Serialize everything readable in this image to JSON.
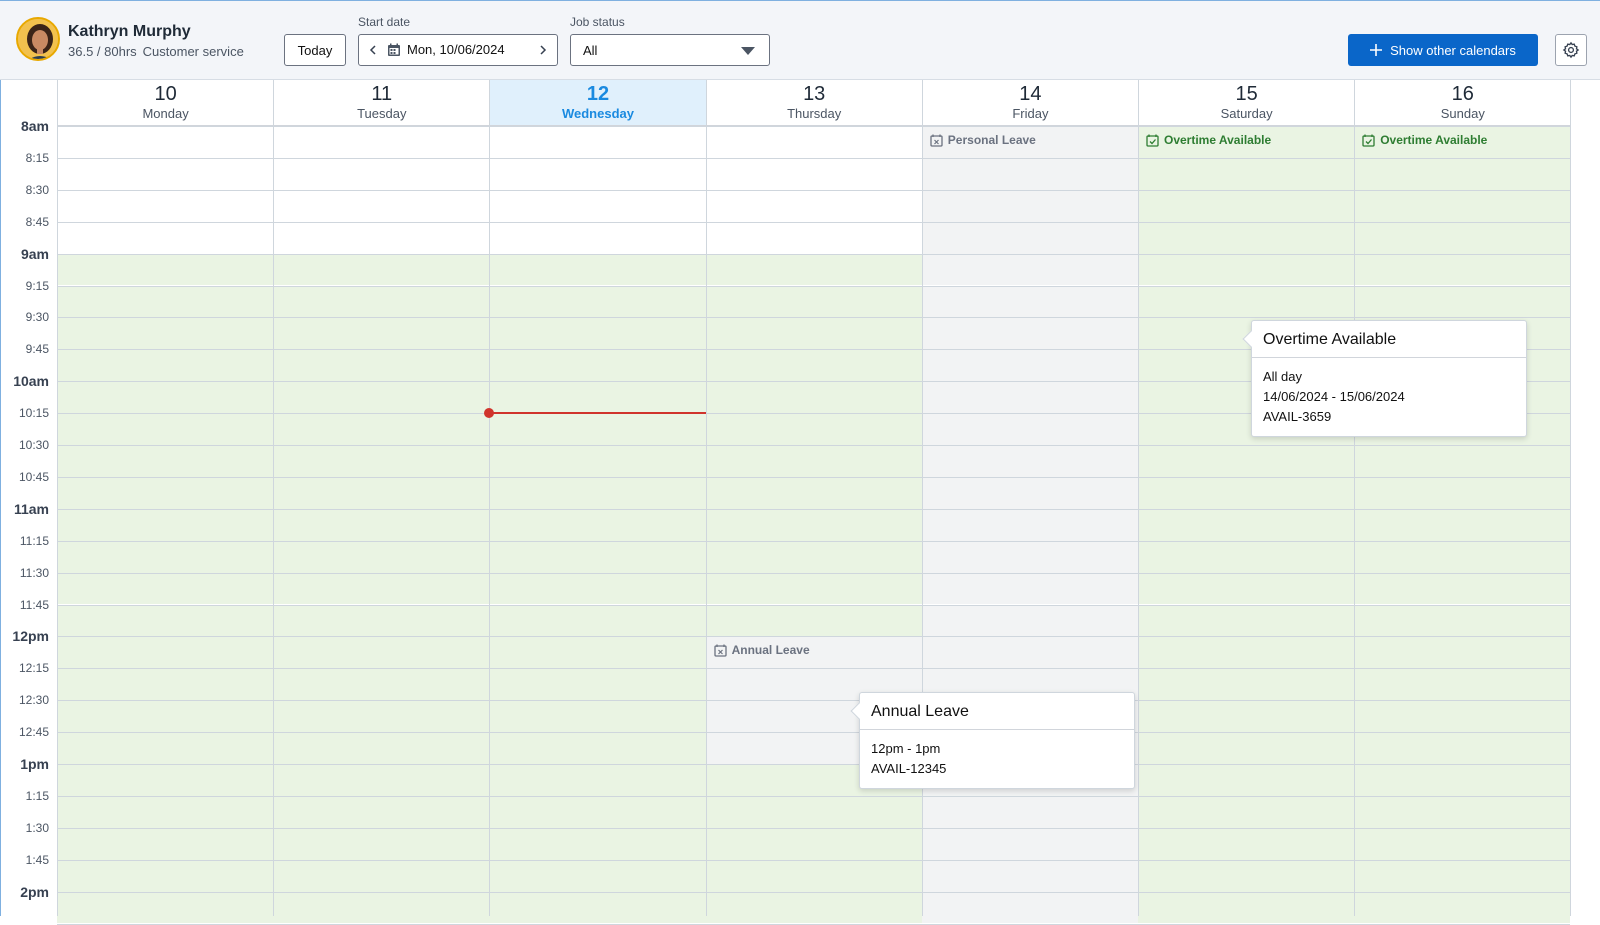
{
  "user": {
    "name": "Kathryn Murphy",
    "hours": "36.5 / 80hrs",
    "department": "Customer service"
  },
  "toolbar": {
    "today_label": "Today",
    "start_date_label": "Start date",
    "start_date_value": "Mon, 10/06/2024",
    "job_status_label": "Job status",
    "job_status_value": "All",
    "show_calendars_label": "Show other calendars"
  },
  "days": [
    {
      "num": "10",
      "name": "Monday"
    },
    {
      "num": "11",
      "name": "Tuesday"
    },
    {
      "num": "12",
      "name": "Wednesday",
      "today": true
    },
    {
      "num": "13",
      "name": "Thursday"
    },
    {
      "num": "14",
      "name": "Friday"
    },
    {
      "num": "15",
      "name": "Saturday"
    },
    {
      "num": "16",
      "name": "Sunday"
    }
  ],
  "times": [
    "8am",
    "8:15",
    "8:30",
    "8:45",
    "9am",
    "9:15",
    "9:30",
    "9:45",
    "10am",
    "10:15",
    "10:30",
    "10:45",
    "11am",
    "11:15",
    "11:30",
    "11:45",
    "12pm",
    "12:15",
    "12:30",
    "12:45",
    "1pm",
    "1:15",
    "1:30",
    "1:45",
    "2pm"
  ],
  "events": {
    "personal_leave": "Personal Leave",
    "overtime_sat": "Overtime Available",
    "overtime_sun": "Overtime Available",
    "annual_leave": "Annual Leave"
  },
  "popover_overtime": {
    "title": "Overtime Available",
    "line1": "All day",
    "line2": "14/06/2024 - 15/06/2024",
    "line3": "AVAIL-3659"
  },
  "popover_annual": {
    "title": "Annual Leave",
    "line1": "12pm - 1pm",
    "line2": "AVAIL-12345"
  },
  "colors": {
    "available_bg": "#eaf4e3",
    "leave_bg": "#f2f3f4",
    "today_header_bg": "#e0f0fc",
    "now_line": "#d0342c",
    "primary": "#0a66c9"
  }
}
